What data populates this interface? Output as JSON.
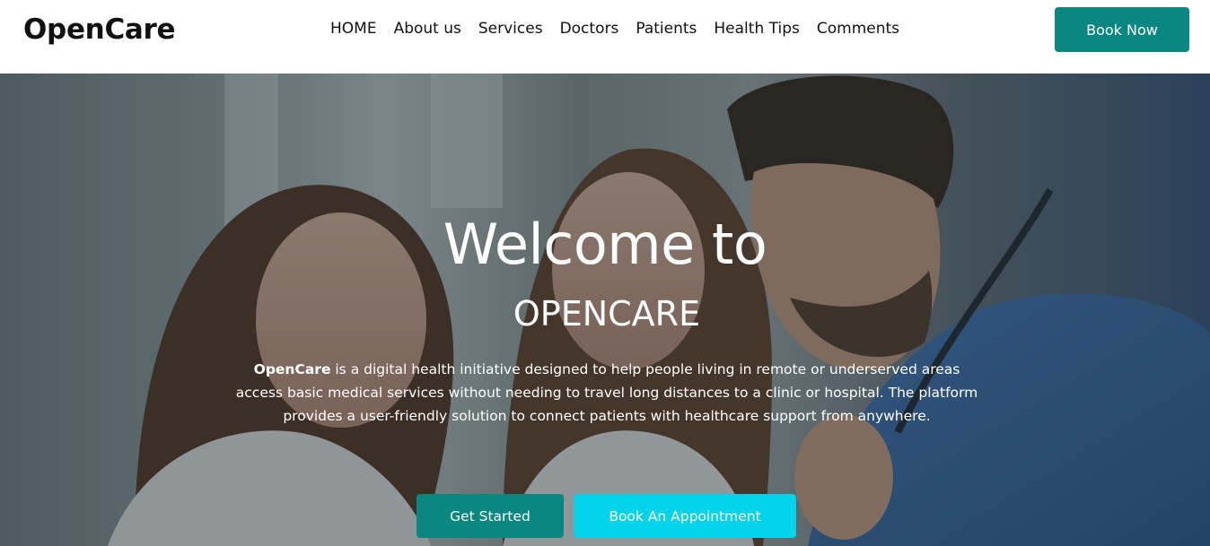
{
  "header": {
    "logo": "OpenCare",
    "nav": [
      {
        "label": "HOME"
      },
      {
        "label": "About us"
      },
      {
        "label": "Services"
      },
      {
        "label": "Doctors"
      },
      {
        "label": "Patients"
      },
      {
        "label": "Health Tips"
      },
      {
        "label": "Comments"
      }
    ],
    "book_now_label": "Book Now"
  },
  "hero": {
    "title": "Welcome to",
    "subtitle": "OPENCARE",
    "desc_brand": "OpenCare",
    "desc_text": " is a digital health initiative designed to help people living in remote or underserved areas access basic medical services without needing to travel long distances to a clinic or hospital. The platform provides a user-friendly solution to connect patients with healthcare support from anywhere.",
    "get_started_label": "Get Started",
    "appointment_label": "Book An Appointment"
  },
  "colors": {
    "primary": "#0a8780",
    "accent": "#05d3eb",
    "text_dark": "#111111",
    "white": "#ffffff"
  }
}
